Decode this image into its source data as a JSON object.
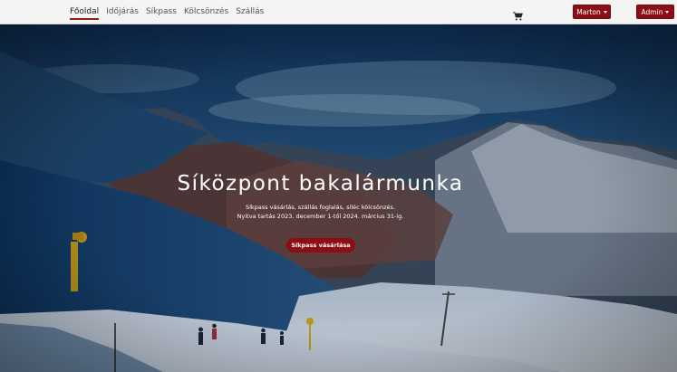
{
  "nav": {
    "links": [
      "Főoldal",
      "Időjárás",
      "Síkpass",
      "Kölcsönzés",
      "Szállás"
    ],
    "active_index": 0,
    "cart_icon": "shopping-cart-icon",
    "user_label": "Marton",
    "admin_label": "Admin"
  },
  "hero": {
    "title": "Síközpont bakalármunka",
    "subtitle_line1": "Síkpass vásárlás, szállás foglalás, síléc kölcsönzés.",
    "subtitle_line2": "Nyitva tartás 2023. december 1-től 2024. március 31-ig.",
    "cta_label": "Síkpass vásárlása"
  },
  "colors": {
    "brand": "#8e0d14",
    "navbar_bg": "#f4f4f4"
  }
}
